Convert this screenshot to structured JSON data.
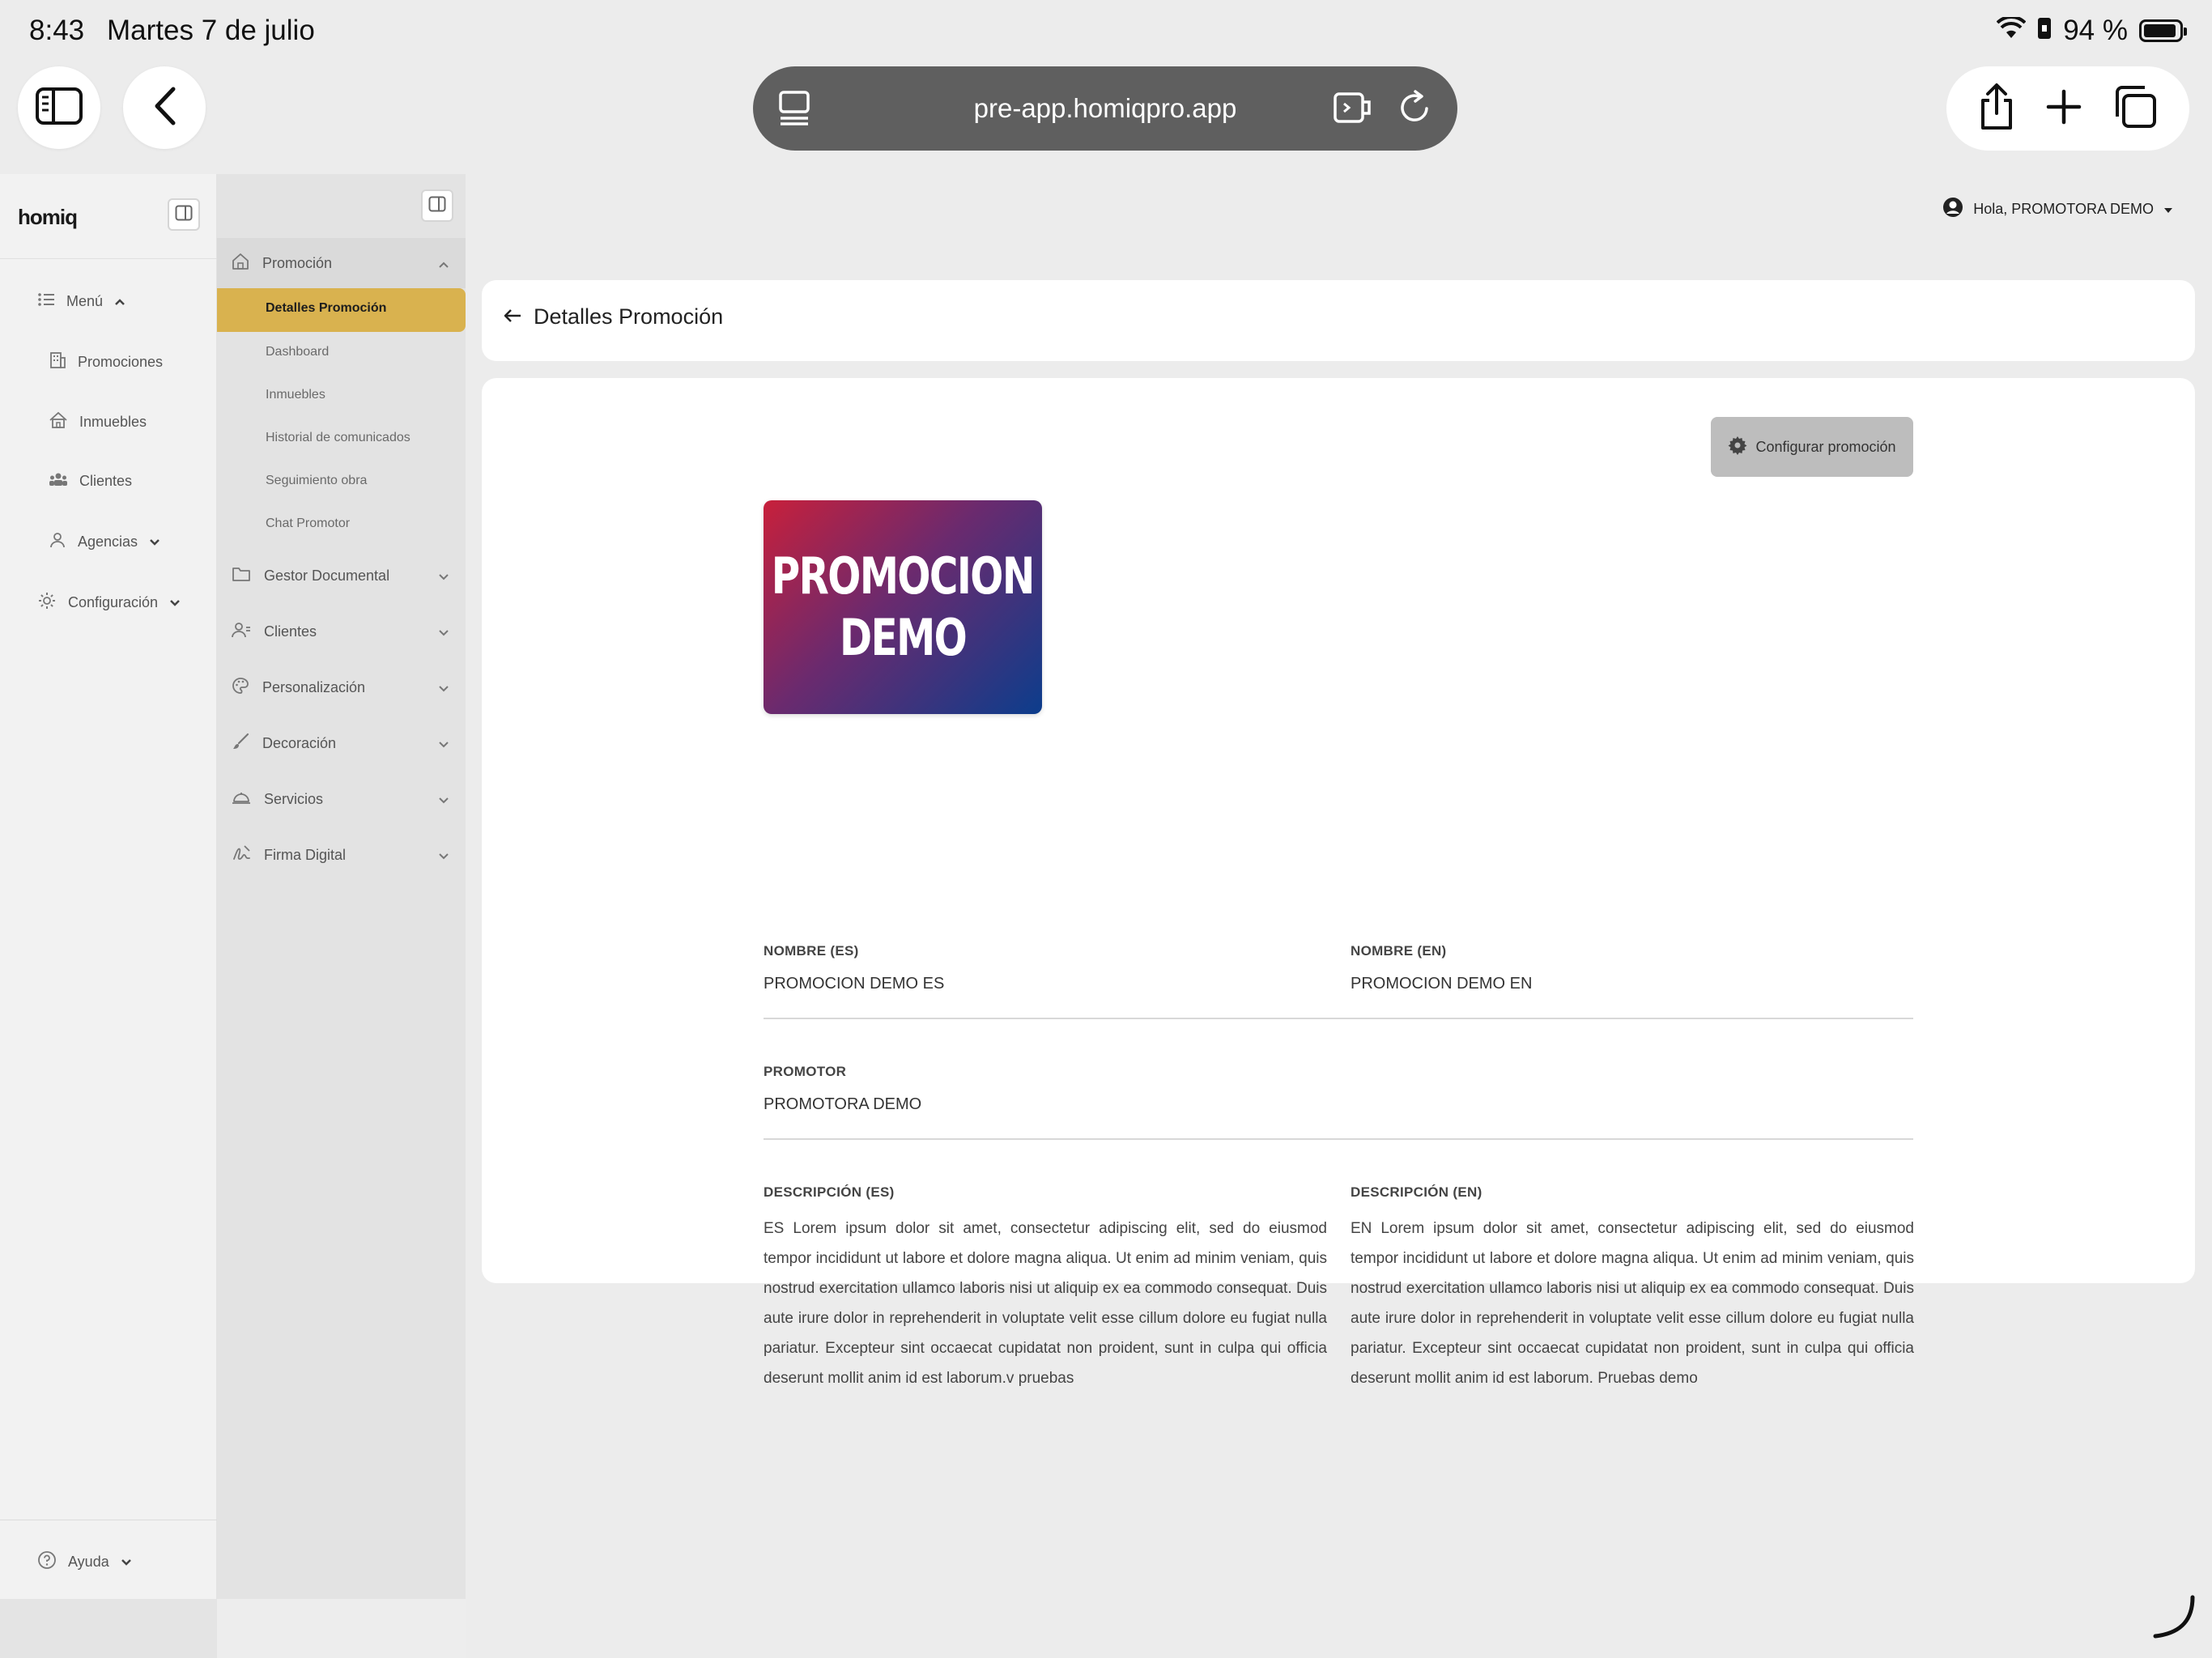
{
  "status": {
    "time": "8:43",
    "date": "Martes 7 de julio",
    "battery": "94 %",
    "battery_level": 0.94
  },
  "browser": {
    "url": "pre-app.homiqpro.app"
  },
  "app": {
    "logo": "homiq",
    "user_greeting": "Hola, PROMOTORA DEMO"
  },
  "sidebar": {
    "menu_label": "Menú",
    "items": [
      {
        "label": "Promociones",
        "icon": "building-icon"
      },
      {
        "label": "Inmuebles",
        "icon": "house-icon"
      },
      {
        "label": "Clientes",
        "icon": "users-icon"
      },
      {
        "label": "Agencias",
        "icon": "person-icon"
      },
      {
        "label": "Configuración",
        "icon": "gear-icon"
      }
    ],
    "help_label": "Ayuda"
  },
  "subnav": {
    "promocion": "Promoción",
    "subitems": [
      "Detalles Promoción",
      "Dashboard",
      "Inmuebles",
      "Historial de comunicados",
      "Seguimiento obra",
      "Chat Promotor"
    ],
    "active": "Detalles Promoción",
    "groups": [
      "Gestor Documental",
      "Clientes",
      "Personalización",
      "Decoración",
      "Servicios",
      "Firma Digital"
    ]
  },
  "page": {
    "title": "Detalles Promoción",
    "config_button": "Configurar promoción",
    "image_text": [
      "PROMOCION",
      "DEMO"
    ],
    "nombre_es_label": "NOMBRE (ES)",
    "nombre_es": "PROMOCION DEMO ES",
    "nombre_en_label": "NOMBRE (EN)",
    "nombre_en": "PROMOCION DEMO EN",
    "promotor_label": "PROMOTOR",
    "promotor": "PROMOTORA DEMO",
    "desc_es_label": "DESCRIPCIÓN (ES)",
    "desc_es": "ES Lorem ipsum dolor sit amet, consectetur adipiscing elit, sed do eiusmod tempor incididunt ut labore et dolore magna aliqua. Ut enim ad minim veniam, quis nostrud exercitation ullamco laboris nisi ut aliquip ex ea commodo consequat. Duis aute irure dolor in reprehenderit in voluptate velit esse cillum dolore eu fugiat nulla pariatur. Excepteur sint occaecat cupidatat non proident, sunt in culpa qui officia deserunt mollit anim id est laborum.v pruebas",
    "desc_en_label": "DESCRIPCIÓN (EN)",
    "desc_en": "EN Lorem ipsum dolor sit amet, consectetur adipiscing elit, sed do eiusmod tempor incididunt ut labore et dolore magna aliqua. Ut enim ad minim veniam, quis nostrud exercitation ullamco laboris nisi ut aliquip ex ea commodo consequat. Duis aute irure dolor in reprehenderit in voluptate velit esse cillum dolore eu fugiat nulla pariatur. Excepteur sint occaecat cupidatat non proident, sunt in culpa qui officia deserunt mollit anim id est laborum. Pruebas demo"
  },
  "colors": {
    "accent": "#d9b24f",
    "url_bar": "#5f5f5f",
    "button_gray": "#bdbdbd"
  }
}
